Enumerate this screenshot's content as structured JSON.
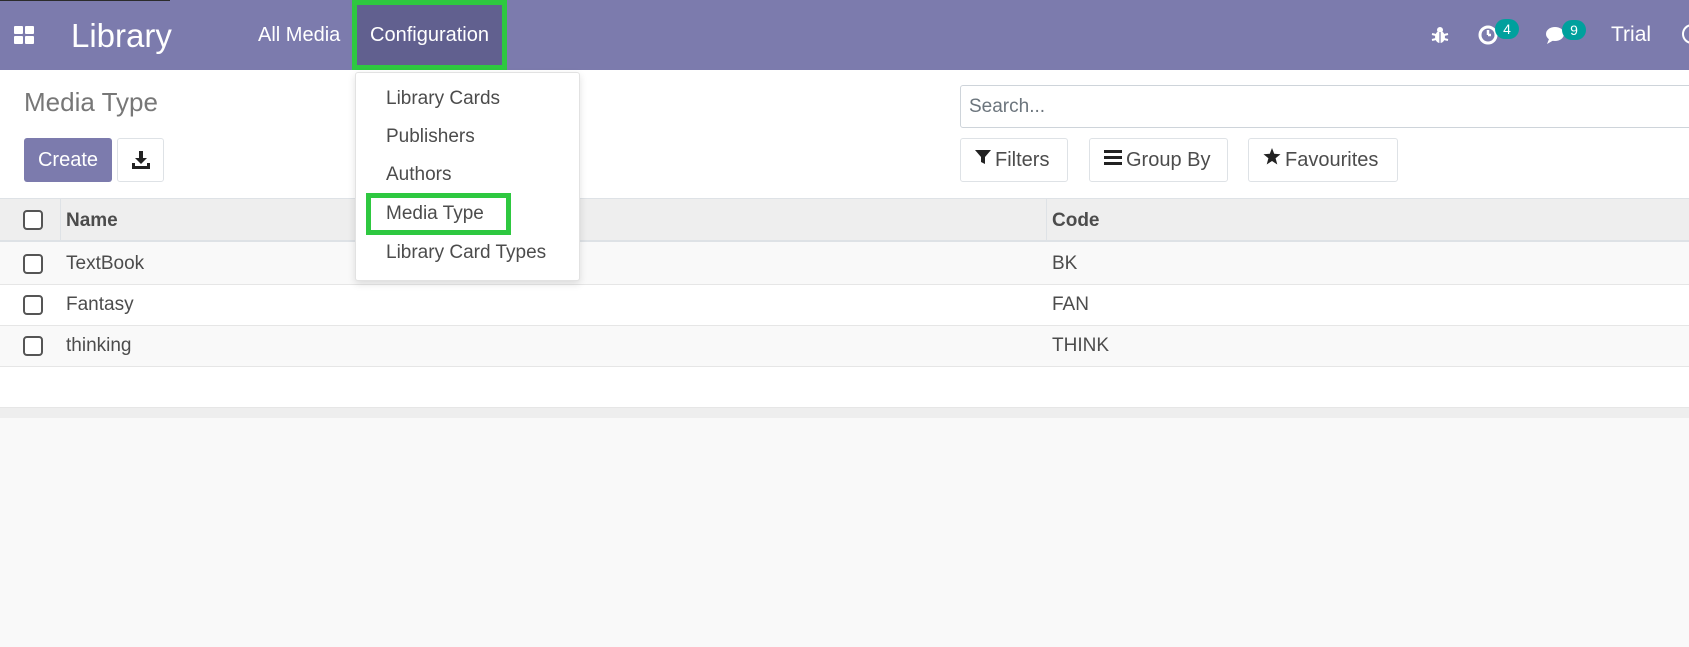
{
  "navbar": {
    "brand": "Library",
    "menu": {
      "all_media": "All Media",
      "configuration": "Configuration"
    },
    "activity_count": "4",
    "messages_count": "9",
    "user": "Trial"
  },
  "configuration_menu": {
    "items": [
      "Library Cards",
      "Publishers",
      "Authors",
      "Media Type",
      "Library Card Types"
    ],
    "highlighted_index": 3
  },
  "control_panel": {
    "title": "Media Type",
    "create_label": "Create",
    "search_placeholder": "Search...",
    "filters_label": "Filters",
    "group_by_label": "Group By",
    "favourites_label": "Favourites"
  },
  "table": {
    "columns": [
      "Name",
      "Code"
    ],
    "rows": [
      {
        "name": "TextBook",
        "code": "BK"
      },
      {
        "name": "Fantasy",
        "code": "FAN"
      },
      {
        "name": "thinking",
        "code": "THINK"
      }
    ]
  },
  "colors": {
    "navbar": "#7c7bad",
    "highlight_outline": "#2ec840",
    "badge": "#00a09d"
  }
}
